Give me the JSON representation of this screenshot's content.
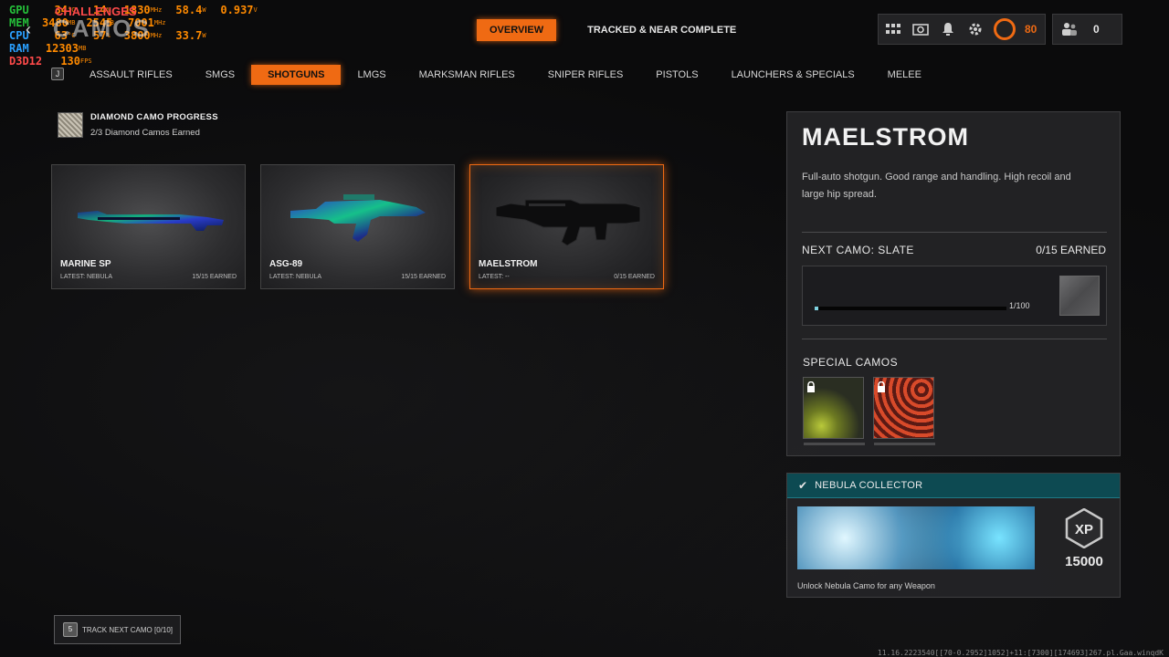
{
  "overlay": {
    "title": "CHALLENGES",
    "rows": [
      {
        "label": "GPU",
        "v1": "34",
        "u1": "°C",
        "v2": "14",
        "u2": "%",
        "v3": "1830",
        "u3": "MHz",
        "v4": "58.4",
        "u4": "W",
        "v5": "0.937",
        "u5": "V"
      },
      {
        "label": "MEM",
        "v1": "3480",
        "u1": "MB",
        "v2": "2545",
        "u2": "MB",
        "v3": "7001",
        "u3": "MHz"
      },
      {
        "label": "CPU",
        "v1": "63",
        "u1": "°C",
        "v2": "57",
        "u2": "%",
        "v3": "3800",
        "u3": "MHz",
        "v4": "33.7",
        "u4": "W"
      },
      {
        "label": "RAM",
        "v1": "12303",
        "u1": "MB"
      },
      {
        "label": "D3D12",
        "v1": "130",
        "u1": "FPS"
      }
    ]
  },
  "header": {
    "page_title": "CAMOS",
    "back_key": "J",
    "tabs": [
      {
        "label": "OVERVIEW",
        "active": true
      },
      {
        "label": "TRACKED & NEAR COMPLETE",
        "active": false
      }
    ],
    "level": "80",
    "friends_count": "0"
  },
  "categories": [
    {
      "label": "ASSAULT RIFLES",
      "active": false
    },
    {
      "label": "SMGS",
      "active": false
    },
    {
      "label": "SHOTGUNS",
      "active": true
    },
    {
      "label": "LMGS",
      "active": false
    },
    {
      "label": "MARKSMAN RIFLES",
      "active": false
    },
    {
      "label": "SNIPER RIFLES",
      "active": false
    },
    {
      "label": "PISTOLS",
      "active": false
    },
    {
      "label": "LAUNCHERS & SPECIALS",
      "active": false
    },
    {
      "label": "MELEE",
      "active": false
    }
  ],
  "diamond": {
    "title": "DIAMOND CAMO PROGRESS",
    "subtitle": "2/3 Diamond Camos Earned"
  },
  "weapons": [
    {
      "name": "MARINE SP",
      "latest": "LATEST: NEBULA",
      "earned": "15/15 EARNED",
      "selected": false,
      "camo": "nebula"
    },
    {
      "name": "ASG-89",
      "latest": "LATEST: NEBULA",
      "earned": "15/15 EARNED",
      "selected": false,
      "camo": "nebula"
    },
    {
      "name": "MAELSTROM",
      "latest": "LATEST: --",
      "earned": "0/15 EARNED",
      "selected": true,
      "camo": "none"
    }
  ],
  "detail": {
    "title": "MAELSTROM",
    "description": "Full-auto shotgun.  Good range and handling. High recoil and large hip spread.",
    "next_camo_label": "NEXT CAMO: SLATE",
    "next_camo_earned": "0/15 EARNED",
    "progress_text": "1/100",
    "progress_fraction": 0.01,
    "special_label": "SPECIAL CAMOS"
  },
  "challenge": {
    "title": "NEBULA COLLECTOR",
    "xp": "15000",
    "description": "Unlock Nebula Camo for any Weapon"
  },
  "track": {
    "key": "5",
    "label": "TRACK NEXT CAMO [0/10]"
  },
  "footer_id": "11.16.2223540[[70-0.2952]1052]+11:[7300][174693]267.pl.Gaa.winqdK",
  "colors": {
    "accent": "#ef6a13",
    "teal_header": "#0d4a52"
  }
}
